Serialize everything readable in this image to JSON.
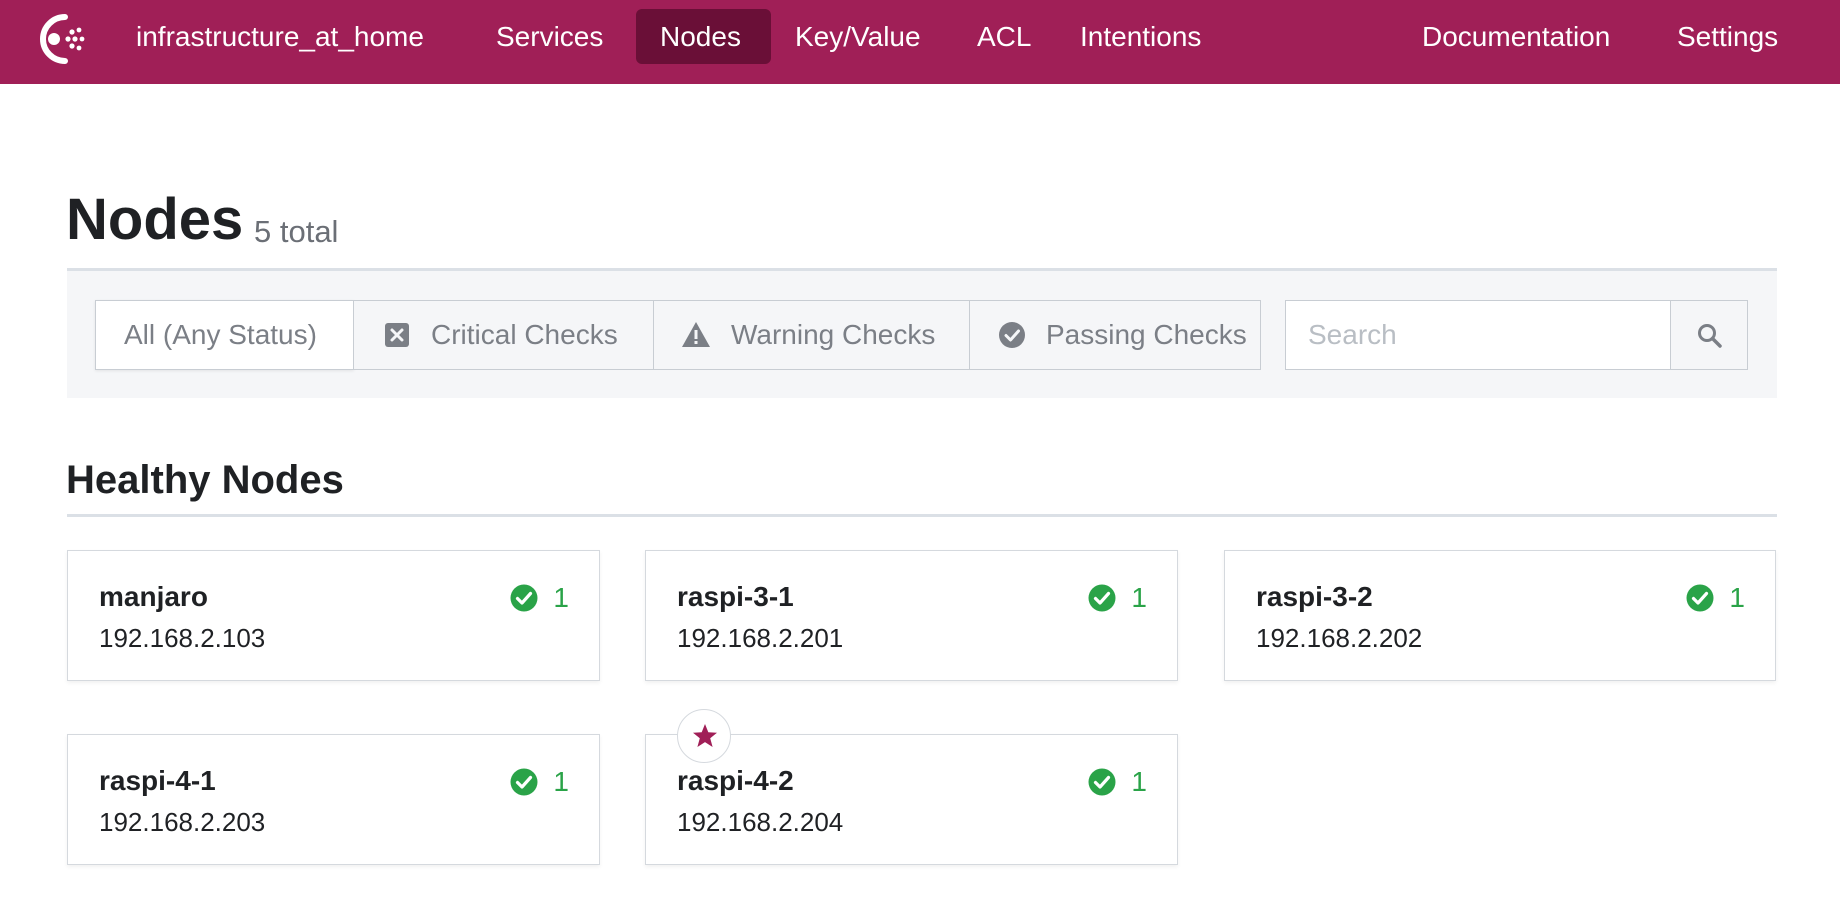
{
  "nav": {
    "datacenter": "infrastructure_at_home",
    "services": "Services",
    "nodes": "Nodes",
    "key_value": "Key/Value",
    "acl": "ACL",
    "intentions": "Intentions",
    "documentation": "Documentation",
    "settings": "Settings",
    "active": "Nodes",
    "brand_color": "#a01f57",
    "active_color": "#6a0f37"
  },
  "header": {
    "title": "Nodes",
    "count": "5 total"
  },
  "filters": {
    "all": "All (Any Status)",
    "critical": "Critical Checks",
    "warning": "Warning Checks",
    "passing": "Passing Checks",
    "selected": "All (Any Status)",
    "search_placeholder": "Search"
  },
  "section": {
    "title": "Healthy Nodes"
  },
  "nodes": [
    {
      "name": "manjaro",
      "address": "192.168.2.103",
      "passing": "1",
      "leader": false
    },
    {
      "name": "raspi-3-1",
      "address": "192.168.2.201",
      "passing": "1",
      "leader": false
    },
    {
      "name": "raspi-3-2",
      "address": "192.168.2.202",
      "passing": "1",
      "leader": false
    },
    {
      "name": "raspi-4-1",
      "address": "192.168.2.203",
      "passing": "1",
      "leader": false
    },
    {
      "name": "raspi-4-2",
      "address": "192.168.2.204",
      "passing": "1",
      "leader": true
    }
  ],
  "colors": {
    "passing": "#2aa348",
    "leader_star": "#a01f57"
  },
  "icons": {
    "logo": "consul-logo-icon",
    "critical": "x-square-icon",
    "warning": "warning-triangle-icon",
    "passing": "check-circle-icon",
    "search": "search-icon",
    "leader": "star-icon"
  }
}
